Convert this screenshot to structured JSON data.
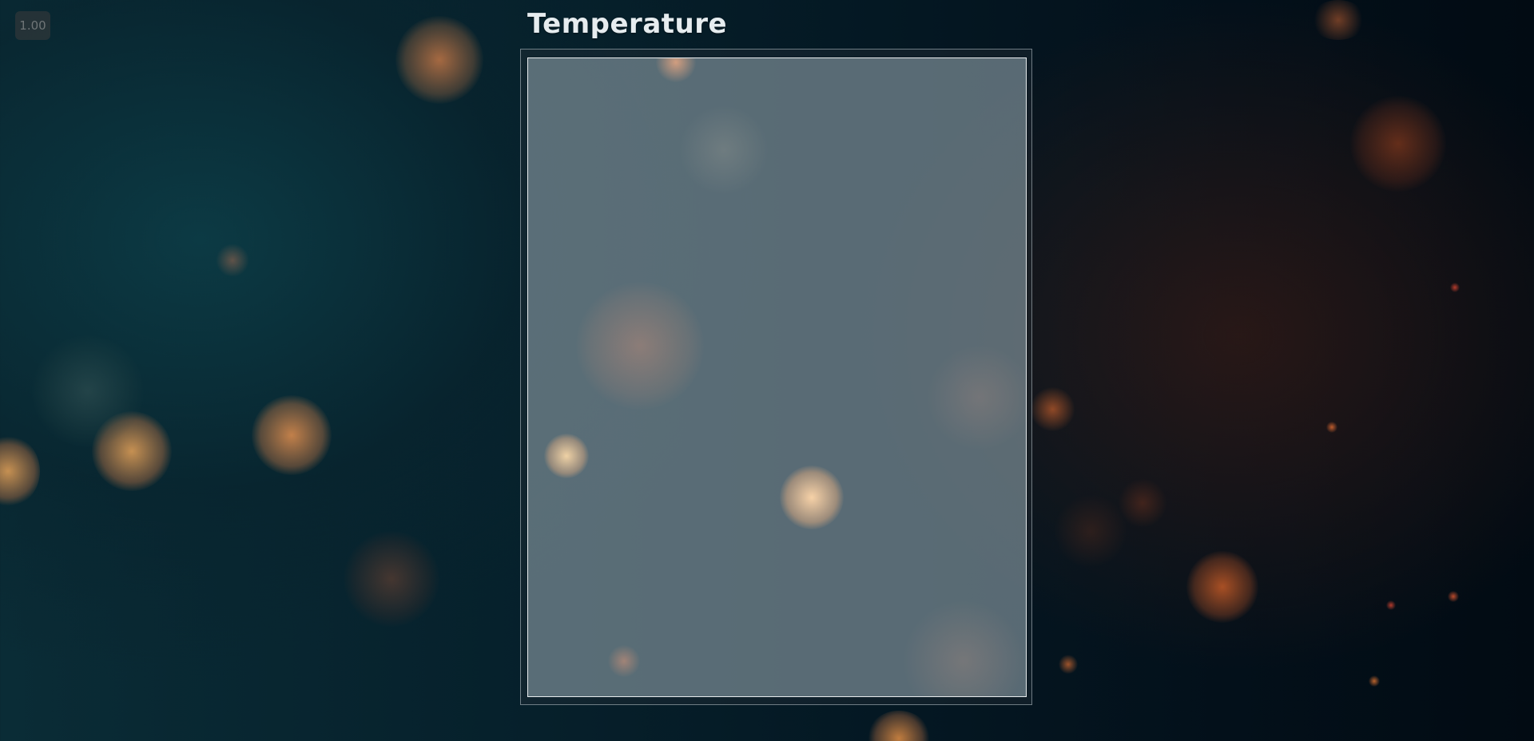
{
  "zoom": {
    "value": "1.00"
  },
  "panel": {
    "title": "Temperature"
  },
  "colors": {
    "background_teal": "#0a2c36",
    "background_dark": "#020b13",
    "bokeh_orange": "#e8874a",
    "panel_fill": "#96aab2",
    "panel_border": "#e8ecee",
    "title_text": "#e6ecef"
  }
}
